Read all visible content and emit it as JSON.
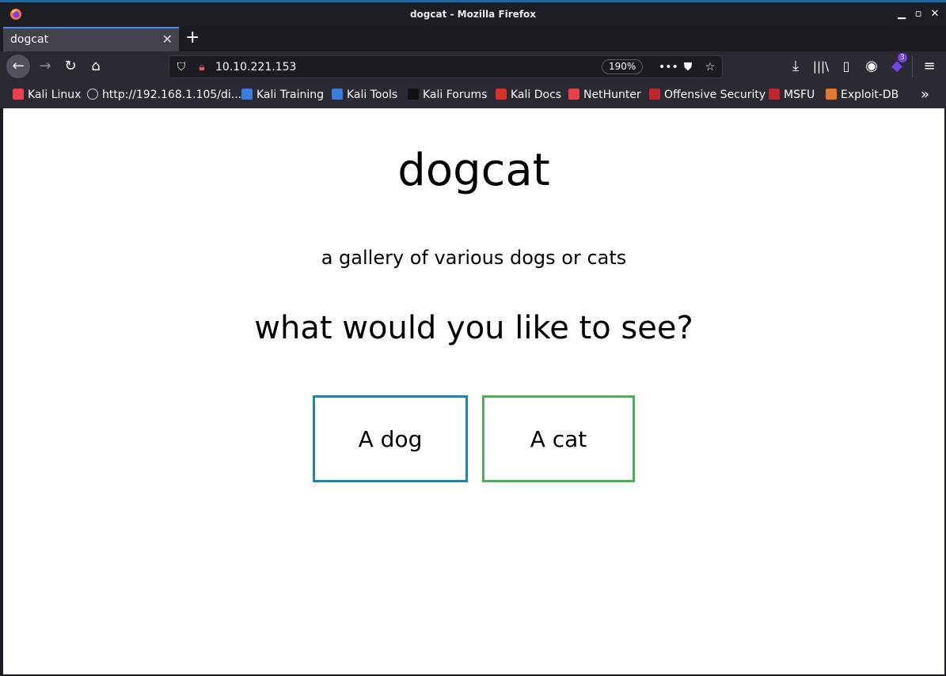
{
  "window": {
    "title": "dogcat - Mozilla Firefox"
  },
  "tabs": [
    {
      "label": "dogcat",
      "close": "✕"
    }
  ],
  "toolbar": {
    "url": "10.10.221.153",
    "zoom": "190%",
    "extensions_badge": "3"
  },
  "bookmarks": [
    {
      "label": "Kali Linux",
      "icon": "kali-icon",
      "color": "#e8404a"
    },
    {
      "label": "http://192.168.1.105/di...",
      "icon": "globe-icon",
      "color": "#cfcfd8"
    },
    {
      "label": "Kali Training",
      "icon": "kali-training-icon",
      "color": "#3b7ddd"
    },
    {
      "label": "Kali Tools",
      "icon": "kali-tools-icon",
      "color": "#3b7ddd"
    },
    {
      "label": "Kali Forums",
      "icon": "kali-forums-icon",
      "color": "#111111"
    },
    {
      "label": "Kali Docs",
      "icon": "kali-docs-icon",
      "color": "#d9322b"
    },
    {
      "label": "NetHunter",
      "icon": "nethunter-icon",
      "color": "#e8404a"
    },
    {
      "label": "Offensive Security",
      "icon": "offsec-icon",
      "color": "#c0262d"
    },
    {
      "label": "MSFU",
      "icon": "msfu-icon",
      "color": "#c0262d"
    },
    {
      "label": "Exploit-DB",
      "icon": "exploitdb-icon",
      "color": "#e8772e"
    }
  ],
  "page": {
    "title": "dogcat",
    "subtitle": "a gallery of various dogs or cats",
    "question": "what would you like to see?",
    "dog_button": "A dog",
    "cat_button": "A cat",
    "dog_border_color": "#1a86b0",
    "cat_border_color": "#4caf50"
  }
}
